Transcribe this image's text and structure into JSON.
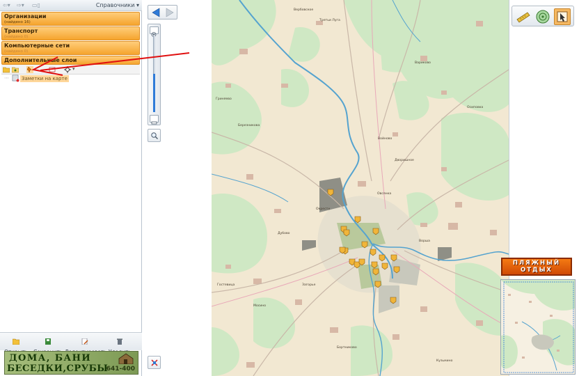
{
  "toolbar": {
    "directories_label": "Справочники"
  },
  "categories": [
    {
      "title": "Организации",
      "subtitle": "(найдено 16)"
    },
    {
      "title": "Транспорт",
      "subtitle": "(найдено 0)"
    },
    {
      "title": "Компьютерные сети",
      "subtitle": "(найдено 0)"
    },
    {
      "title": "Дополнительные слои",
      "subtitle": ""
    }
  ],
  "tree": {
    "node_label": "Заметки на карте"
  },
  "actions": {
    "open": "Открыть",
    "save": "Сохранить",
    "edit": "Редактировать",
    "delete": "Удалить"
  },
  "ad": {
    "line1": "ДОМА, БАНИ",
    "line2": "БЕСЕДКИ,СРУБЫ",
    "phone": "641-400"
  },
  "banner": {
    "line1": "ПЛЯЖНЫЙ",
    "line2": "ОТДЫХ"
  },
  "zoom_level": 0.5,
  "colors": {
    "category_orange": "#f5a42e",
    "map_land": "#f2e8d2",
    "map_forest": "#cfe8c4",
    "map_water": "#55a3cf",
    "marker": "#f0b53a",
    "annotation_arrow": "#e01010"
  },
  "icons": [
    "back-arrow-icon",
    "forward-arrow-icon",
    "zoom-in-icon",
    "zoom-out-icon",
    "magnifier-icon",
    "reset-view-icon",
    "folder-icon",
    "save-icon",
    "edit-icon",
    "trash-icon",
    "ruler-icon",
    "radar-icon",
    "pointer-icon",
    "note-icon"
  ]
}
